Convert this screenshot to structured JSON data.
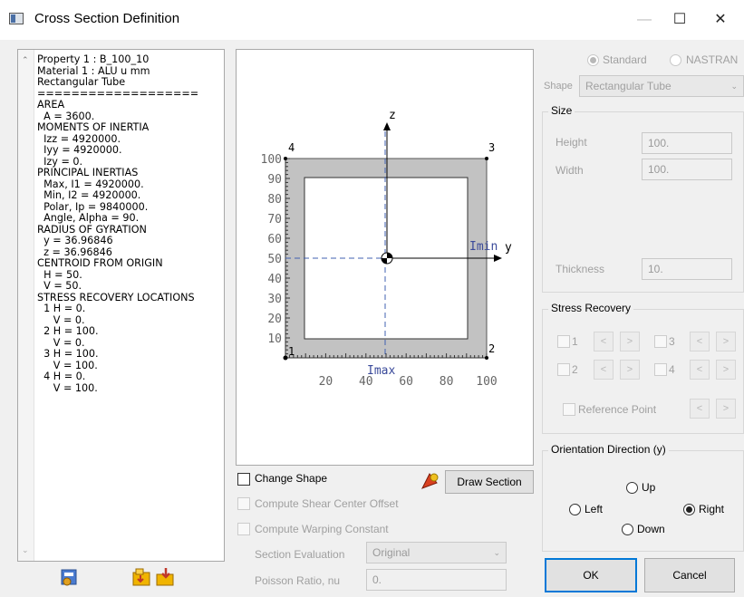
{
  "window": {
    "title": "Cross Section Definition",
    "minimize": "—",
    "maximize": "☐",
    "close": "✕"
  },
  "properties_text": "Property 1 : B_100_10\nMaterial 1 : ALU u mm\nRectangular Tube\n===================\nAREA\n  A = 3600.\nMOMENTS OF INERTIA\n  Izz = 4920000.\n  Iyy = 4920000.\n  Izy = 0.\nPRINCIPAL INERTIAS\n  Max, I1 = 4920000.\n  Min, I2 = 4920000.\n  Polar, Ip = 9840000.\n  Angle, Alpha = 90.\nRADIUS OF GYRATION\n  y = 36.96846\n  z = 36.96846\nCENTROID FROM ORIGIN\n  H = 50.\n  V = 50.\nSTRESS RECOVERY LOCATIONS\n  1 H = 0.\n     V = 0.\n  2 H = 100.\n     V = 0.\n  3 H = 100.\n     V = 100.\n  4 H = 0.\n     V = 100.",
  "drawing": {
    "z_label": "z",
    "y_label": "y",
    "imin_label": "Imin",
    "imax_label": "Imax",
    "y_ticks": [
      "100",
      "90",
      "80",
      "70",
      "60",
      "50",
      "40",
      "30",
      "20",
      "10"
    ],
    "x_ticks": [
      "20",
      "40",
      "60",
      "80",
      "100"
    ],
    "corner_labels": [
      "1",
      "2",
      "3",
      "4"
    ]
  },
  "options": {
    "change_shape": "Change Shape",
    "draw_section": "Draw Section",
    "compute_shear": "Compute Shear Center Offset",
    "compute_warping": "Compute Warping Constant",
    "section_eval_label": "Section Evaluation",
    "section_eval_value": "Original",
    "poisson_label": "Poisson Ratio, nu",
    "poisson_value": "0."
  },
  "right": {
    "standard": "Standard",
    "nastran": "NASTRAN",
    "shape_label": "Shape",
    "shape_value": "Rectangular Tube",
    "size_title": "Size",
    "height_label": "Height",
    "height_value": "100.",
    "width_label": "Width",
    "width_value": "100.",
    "thickness_label": "Thickness",
    "thickness_value": "10.",
    "stress_title": "Stress Recovery",
    "sr1": "1",
    "sr2": "2",
    "sr3": "3",
    "sr4": "4",
    "less": "<",
    "greater": ">",
    "reference_point": "Reference Point",
    "orientation_title": "Orientation Direction (y)",
    "up": "Up",
    "left": "Left",
    "right": "Right",
    "down": "Down",
    "ok": "OK",
    "cancel": "Cancel"
  }
}
